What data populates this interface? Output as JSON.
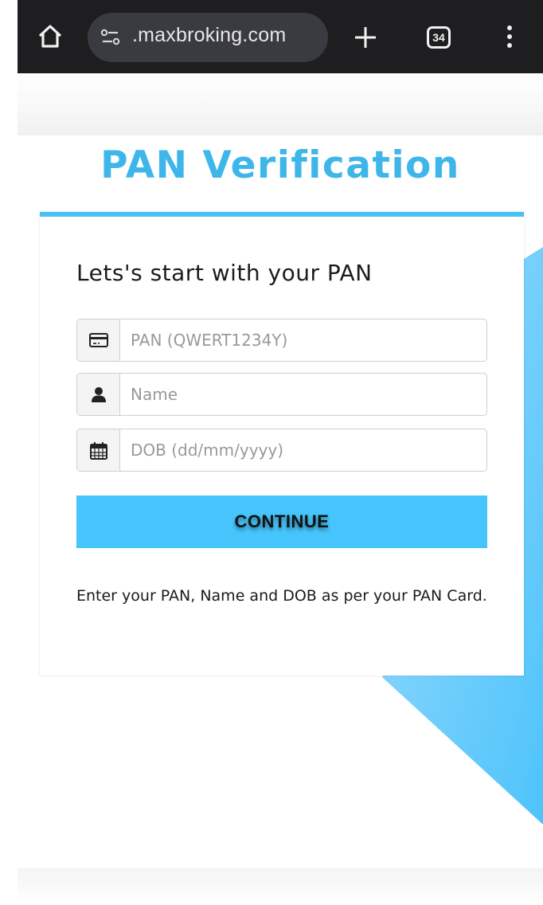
{
  "browser": {
    "url": ".maxbroking.com",
    "tab_count": "34",
    "icons": [
      "home-icon",
      "site-settings-icon",
      "new-tab-icon",
      "tab-switcher-icon",
      "overflow-menu-icon"
    ]
  },
  "page": {
    "title": "PAN Verification",
    "accent_color": "#45c1f2"
  },
  "form": {
    "heading": "Lets's start with your PAN",
    "pan_placeholder": "PAN (QWERT1234Y)",
    "name_placeholder": "Name",
    "dob_placeholder": "DOB (dd/mm/yyyy)",
    "pan_icon": "credit-card-icon",
    "name_icon": "user-icon",
    "dob_icon": "calendar-icon",
    "continue_label": "CONTINUE",
    "help_text": "Enter your PAN, Name and DOB as per your PAN Card."
  }
}
